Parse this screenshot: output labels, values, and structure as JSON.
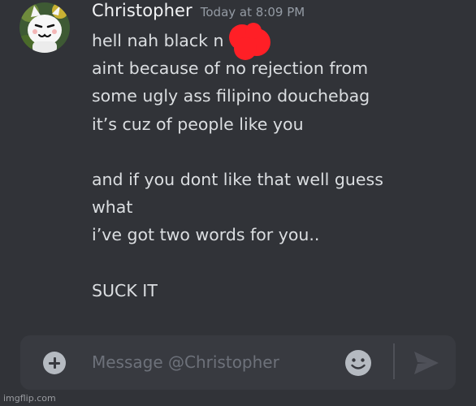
{
  "message": {
    "username": "Christopher",
    "timestamp": "Today at 8:09 PM",
    "lines": [
      "hell nah black n",
      "aint because of no rejection from",
      "some ugly ass filipino douchebag",
      "it’s cuz of people like you",
      "",
      "and if you dont like that well guess",
      "what",
      "i’ve got two words for you..",
      "",
      "SUCK IT"
    ]
  },
  "composer": {
    "placeholder": "Message @Christopher"
  },
  "watermark": "imgflip.com",
  "icons": {
    "add": "plus-circle-icon",
    "emoji": "smiley-icon",
    "send": "send-arrow-icon"
  },
  "colors": {
    "background": "#313338",
    "composer": "#383a40",
    "username": "#f2f3f5",
    "message_text": "#dbdee1",
    "timestamp": "#949ba4",
    "censor": "#ff1f26"
  }
}
